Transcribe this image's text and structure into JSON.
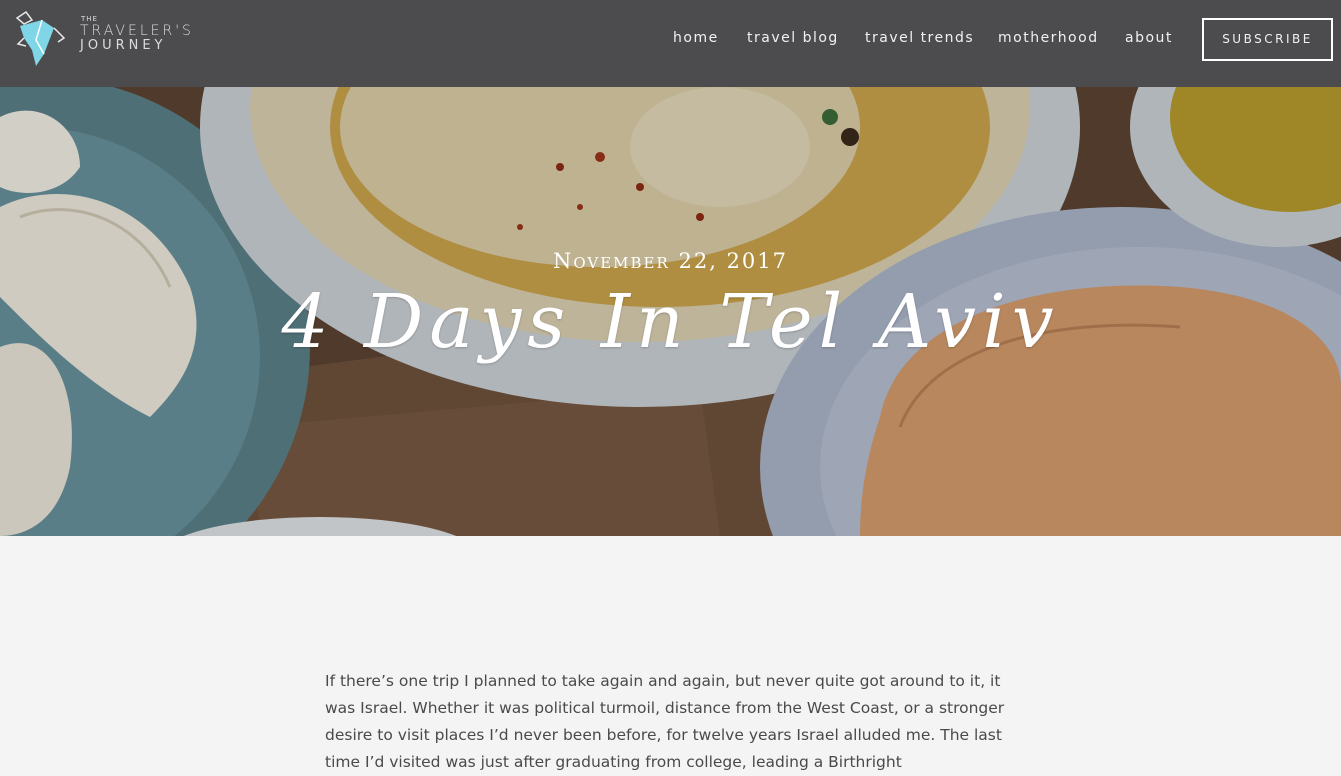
{
  "header": {
    "logo": {
      "small": "THE",
      "line1": "TRAVELER'S",
      "line2": "JOURNEY"
    },
    "nav": {
      "home": "home",
      "travel_blog": "travel blog",
      "travel_trends": "travel trends",
      "motherhood": "motherhood",
      "about": "about"
    },
    "subscribe": "SUBSCRIBE"
  },
  "hero": {
    "date": "November 22, 2017",
    "title": "4 Days In Tel Aviv"
  },
  "article": {
    "lead": "If there’s one trip I planned to take again and again, but never quite got around to it, it was Israel. Whether it was political turmoil, distance from the West Coast, or a stronger desire to visit places I’d never been before, for twelve years Israel alluded me. The last time I’d visited was just after graduating from college, leading a Birthright"
  }
}
